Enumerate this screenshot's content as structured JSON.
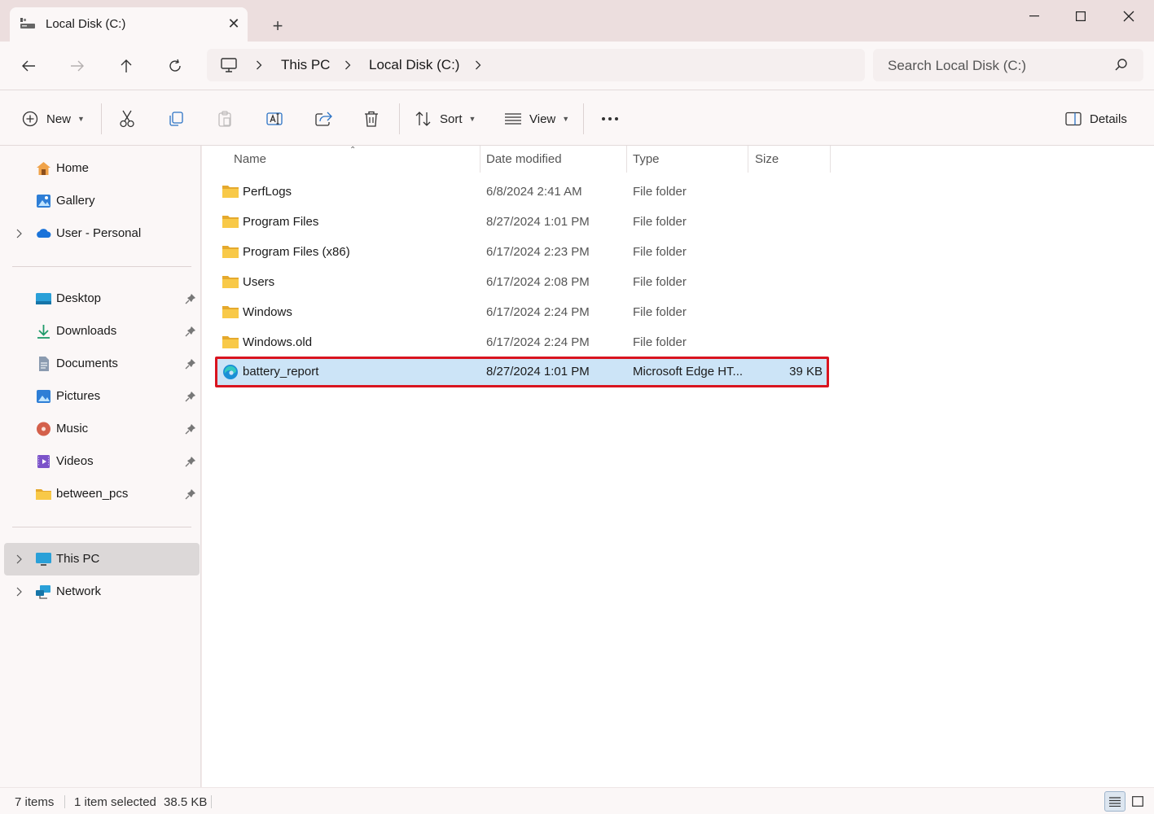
{
  "window": {
    "tab_title": "Local Disk (C:)",
    "new_tab_symbol": "+",
    "tab_close_symbol": "✕"
  },
  "address": {
    "crumbs": [
      "This PC",
      "Local Disk (C:)"
    ],
    "search_placeholder": "Search Local Disk (C:)"
  },
  "toolbar": {
    "new_label": "New",
    "sort_label": "Sort",
    "view_label": "View",
    "details_label": "Details"
  },
  "sidebar": {
    "top_items": [
      {
        "label": "Home",
        "icon": "home-icon"
      },
      {
        "label": "Gallery",
        "icon": "gallery-icon"
      },
      {
        "label": "User - Personal",
        "icon": "onedrive-icon"
      }
    ],
    "pinned_items": [
      {
        "label": "Desktop",
        "icon": "desktop-icon"
      },
      {
        "label": "Downloads",
        "icon": "downloads-icon"
      },
      {
        "label": "Documents",
        "icon": "documents-icon"
      },
      {
        "label": "Pictures",
        "icon": "pictures-icon"
      },
      {
        "label": "Music",
        "icon": "music-icon"
      },
      {
        "label": "Videos",
        "icon": "videos-icon"
      },
      {
        "label": "between_pcs",
        "icon": "folder-icon"
      }
    ],
    "bottom_items": [
      {
        "label": "This PC",
        "icon": "this-pc-icon",
        "selected": true
      },
      {
        "label": "Network",
        "icon": "network-icon"
      }
    ]
  },
  "columns": {
    "name": "Name",
    "date": "Date modified",
    "type": "Type",
    "size": "Size"
  },
  "files": [
    {
      "name": "PerfLogs",
      "date": "6/8/2024 2:41 AM",
      "type": "File folder",
      "size": ""
    },
    {
      "name": "Program Files",
      "date": "8/27/2024 1:01 PM",
      "type": "File folder",
      "size": ""
    },
    {
      "name": "Program Files (x86)",
      "date": "6/17/2024 2:23 PM",
      "type": "File folder",
      "size": ""
    },
    {
      "name": "Users",
      "date": "6/17/2024 2:08 PM",
      "type": "File folder",
      "size": ""
    },
    {
      "name": "Windows",
      "date": "6/17/2024 2:24 PM",
      "type": "File folder",
      "size": ""
    },
    {
      "name": "Windows.old",
      "date": "6/17/2024 2:24 PM",
      "type": "File folder",
      "size": ""
    },
    {
      "name": "battery_report",
      "date": "8/27/2024 1:01 PM",
      "type": "Microsoft Edge HT...",
      "size": "39 KB",
      "selected": true
    }
  ],
  "status": {
    "item_count": "7 items",
    "selection": "1 item selected",
    "selection_size": "38.5 KB"
  },
  "colors": {
    "selection": "#cce4f7",
    "highlight_border": "#d9141f",
    "folder": "#f8c948"
  }
}
